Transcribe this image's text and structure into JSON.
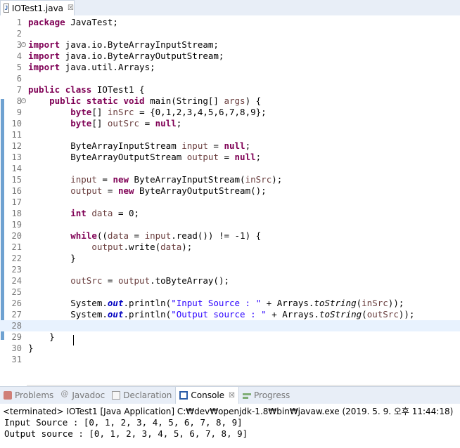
{
  "editor_tab": {
    "icon": "java-file-icon",
    "title": "IOTest1.java",
    "close_glyph": "☒"
  },
  "code": {
    "lines": [
      {
        "n": "1",
        "tokens": [
          [
            "kw",
            "package"
          ],
          [
            "pln",
            " JavaTest;"
          ]
        ]
      },
      {
        "n": "2",
        "tokens": []
      },
      {
        "n": "3",
        "fold": "-",
        "tokens": [
          [
            "kw",
            "import"
          ],
          [
            "pln",
            " java.io.ByteArrayInputStream;"
          ]
        ]
      },
      {
        "n": "4",
        "tokens": [
          [
            "kw",
            "import"
          ],
          [
            "pln",
            " java.io.ByteArrayOutputStream;"
          ]
        ]
      },
      {
        "n": "5",
        "tokens": [
          [
            "kw",
            "import"
          ],
          [
            "pln",
            " java.util.Arrays;"
          ]
        ]
      },
      {
        "n": "6",
        "tokens": []
      },
      {
        "n": "7",
        "tokens": [
          [
            "kw",
            "public"
          ],
          [
            "pln",
            " "
          ],
          [
            "kw",
            "class"
          ],
          [
            "pln",
            " IOTest1 {"
          ]
        ]
      },
      {
        "n": "8",
        "fold": "-",
        "tokens": [
          [
            "pln",
            "    "
          ],
          [
            "kw",
            "public"
          ],
          [
            "pln",
            " "
          ],
          [
            "kw",
            "static"
          ],
          [
            "pln",
            " "
          ],
          [
            "kw",
            "void"
          ],
          [
            "pln",
            " main(String[] "
          ],
          [
            "var",
            "args"
          ],
          [
            "pln",
            ") {"
          ]
        ]
      },
      {
        "n": "9",
        "tokens": [
          [
            "pln",
            "        "
          ],
          [
            "kw",
            "byte"
          ],
          [
            "pln",
            "[] "
          ],
          [
            "var",
            "inSrc"
          ],
          [
            "pln",
            " = {0,1,2,3,4,5,6,7,8,9};"
          ]
        ]
      },
      {
        "n": "10",
        "tokens": [
          [
            "pln",
            "        "
          ],
          [
            "kw",
            "byte"
          ],
          [
            "pln",
            "[] "
          ],
          [
            "var",
            "outSrc"
          ],
          [
            "pln",
            " = "
          ],
          [
            "kw",
            "null"
          ],
          [
            "pln",
            ";"
          ]
        ]
      },
      {
        "n": "11",
        "tokens": []
      },
      {
        "n": "12",
        "tokens": [
          [
            "pln",
            "        ByteArrayInputStream "
          ],
          [
            "var",
            "input"
          ],
          [
            "pln",
            " = "
          ],
          [
            "kw",
            "null"
          ],
          [
            "pln",
            ";"
          ]
        ]
      },
      {
        "n": "13",
        "tokens": [
          [
            "pln",
            "        ByteArrayOutputStream "
          ],
          [
            "var",
            "output"
          ],
          [
            "pln",
            " = "
          ],
          [
            "kw",
            "null"
          ],
          [
            "pln",
            ";"
          ]
        ]
      },
      {
        "n": "14",
        "tokens": []
      },
      {
        "n": "15",
        "tokens": [
          [
            "pln",
            "        "
          ],
          [
            "var",
            "input"
          ],
          [
            "pln",
            " = "
          ],
          [
            "kw",
            "new"
          ],
          [
            "pln",
            " ByteArrayInputStream("
          ],
          [
            "var",
            "inSrc"
          ],
          [
            "pln",
            ");"
          ]
        ]
      },
      {
        "n": "16",
        "tokens": [
          [
            "pln",
            "        "
          ],
          [
            "var",
            "output"
          ],
          [
            "pln",
            " = "
          ],
          [
            "kw",
            "new"
          ],
          [
            "pln",
            " ByteArrayOutputStream();"
          ]
        ]
      },
      {
        "n": "17",
        "tokens": []
      },
      {
        "n": "18",
        "tokens": [
          [
            "pln",
            "        "
          ],
          [
            "kw",
            "int"
          ],
          [
            "pln",
            " "
          ],
          [
            "var",
            "data"
          ],
          [
            "pln",
            " = 0;"
          ]
        ]
      },
      {
        "n": "19",
        "tokens": []
      },
      {
        "n": "20",
        "tokens": [
          [
            "pln",
            "        "
          ],
          [
            "kw",
            "while"
          ],
          [
            "pln",
            "(("
          ],
          [
            "var",
            "data"
          ],
          [
            "pln",
            " = "
          ],
          [
            "var",
            "input"
          ],
          [
            "pln",
            ".read()) != -1) {"
          ]
        ]
      },
      {
        "n": "21",
        "tokens": [
          [
            "pln",
            "            "
          ],
          [
            "var",
            "output"
          ],
          [
            "pln",
            ".write("
          ],
          [
            "var",
            "data"
          ],
          [
            "pln",
            ");"
          ]
        ]
      },
      {
        "n": "22",
        "tokens": [
          [
            "pln",
            "        }"
          ]
        ]
      },
      {
        "n": "23",
        "tokens": []
      },
      {
        "n": "24",
        "tokens": [
          [
            "pln",
            "        "
          ],
          [
            "var",
            "outSrc"
          ],
          [
            "pln",
            " = "
          ],
          [
            "var",
            "output"
          ],
          [
            "pln",
            ".toByteArray();"
          ]
        ]
      },
      {
        "n": "25",
        "tokens": []
      },
      {
        "n": "26",
        "tokens": [
          [
            "pln",
            "        System."
          ],
          [
            "fld",
            "out"
          ],
          [
            "pln",
            ".println("
          ],
          [
            "str",
            "\"Input Source : \""
          ],
          [
            "pln",
            " + Arrays."
          ],
          [
            "ital",
            "toString"
          ],
          [
            "pln",
            "("
          ],
          [
            "var",
            "inSrc"
          ],
          [
            "pln",
            "));"
          ]
        ]
      },
      {
        "n": "27",
        "tokens": [
          [
            "pln",
            "        System."
          ],
          [
            "fld",
            "out"
          ],
          [
            "pln",
            ".println("
          ],
          [
            "str",
            "\"Output source : \""
          ],
          [
            "pln",
            " + Arrays."
          ],
          [
            "ital",
            "toString"
          ],
          [
            "pln",
            "("
          ],
          [
            "var",
            "outSrc"
          ],
          [
            "pln",
            "));"
          ]
        ]
      },
      {
        "n": "28",
        "current": true,
        "tokens": []
      },
      {
        "n": "29",
        "tokens": [
          [
            "pln",
            "    }"
          ]
        ]
      },
      {
        "n": "30",
        "tokens": [
          [
            "pln",
            "}"
          ]
        ]
      },
      {
        "n": "31",
        "tokens": []
      }
    ]
  },
  "hscroll": {
    "left_arrow": "<"
  },
  "view_tabs": [
    {
      "id": "problems",
      "label": "Problems",
      "icon": "problems-icon"
    },
    {
      "id": "javadoc",
      "label": "Javadoc",
      "icon": "javadoc-icon"
    },
    {
      "id": "declaration",
      "label": "Declaration",
      "icon": "declaration-icon"
    },
    {
      "id": "console",
      "label": "Console",
      "icon": "console-icon",
      "active": true,
      "close_glyph": "☒"
    },
    {
      "id": "progress",
      "label": "Progress",
      "icon": "progress-icon"
    }
  ],
  "console": {
    "header": "<terminated> IOTest1 [Java Application] C:₩dev₩openjdk-1.8₩bin₩javaw.exe (2019. 5. 9. 오후 11:44:18)",
    "output": [
      "Input Source : [0, 1, 2, 3, 4, 5, 6, 7, 8, 9]",
      "Output source : [0, 1, 2, 3, 4, 5, 6, 7, 8, 9]"
    ]
  }
}
